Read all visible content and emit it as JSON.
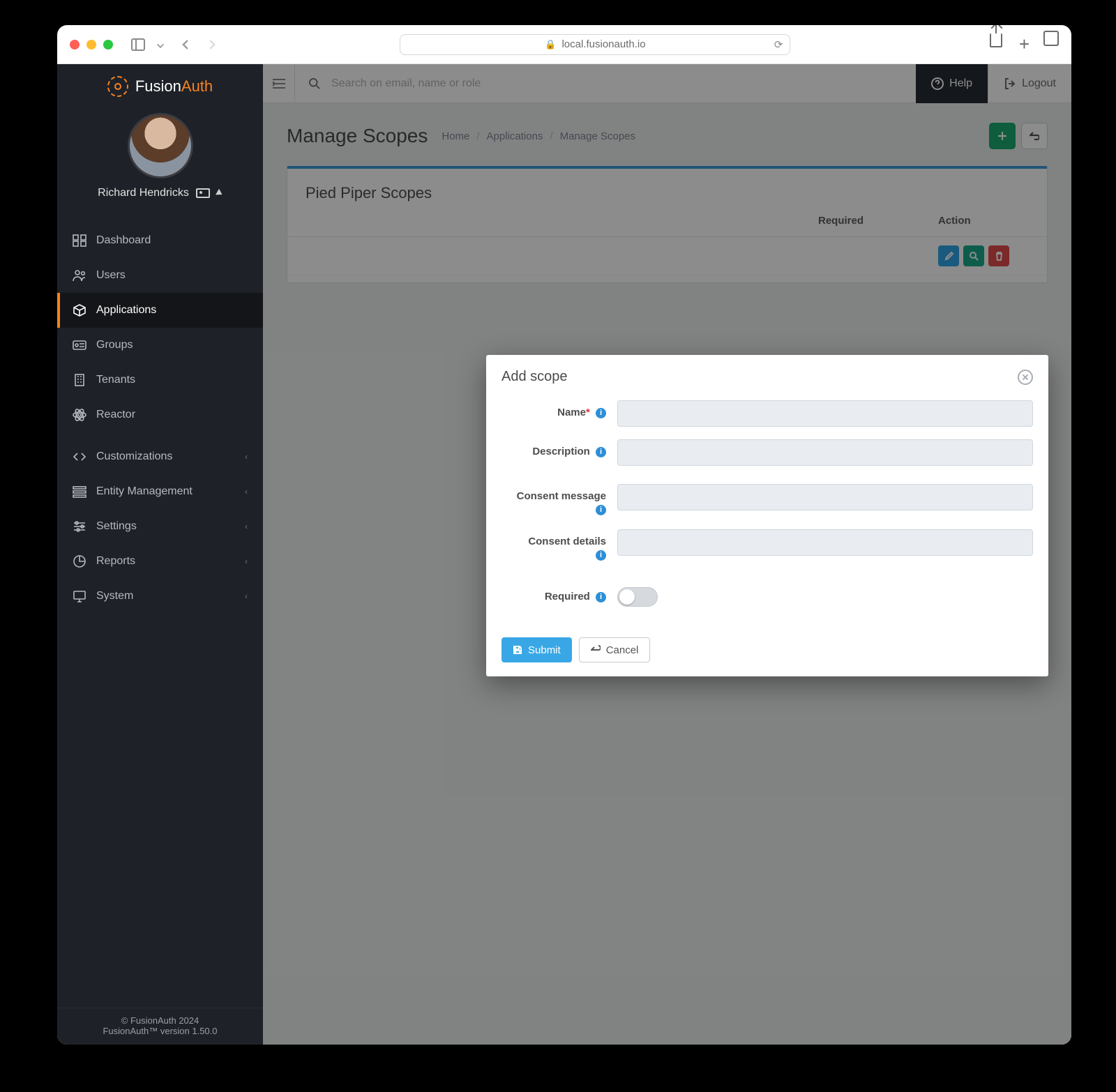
{
  "browser": {
    "address": "local.fusionauth.io"
  },
  "brand": {
    "name_a": "Fusion",
    "name_b": "Auth"
  },
  "user": {
    "name": "Richard Hendricks"
  },
  "footer": {
    "copyright": "© FusionAuth 2024",
    "version": "FusionAuth™ version 1.50.0"
  },
  "topbar": {
    "search_placeholder": "Search on email, name or role",
    "help": "Help",
    "logout": "Logout"
  },
  "page": {
    "title": "Manage Scopes",
    "crumbs": [
      "Home",
      "Applications",
      "Manage Scopes"
    ]
  },
  "panel": {
    "title": "Pied Piper Scopes",
    "columns": {
      "required": "Required",
      "action": "Action"
    }
  },
  "nav": [
    {
      "label": "Dashboard",
      "icon": "grid"
    },
    {
      "label": "Users",
      "icon": "users"
    },
    {
      "label": "Applications",
      "icon": "cube",
      "active": true
    },
    {
      "label": "Groups",
      "icon": "groups"
    },
    {
      "label": "Tenants",
      "icon": "building"
    },
    {
      "label": "Reactor",
      "icon": "atom"
    }
  ],
  "nav2": [
    {
      "label": "Customizations",
      "icon": "code"
    },
    {
      "label": "Entity Management",
      "icon": "entity"
    },
    {
      "label": "Settings",
      "icon": "sliders"
    },
    {
      "label": "Reports",
      "icon": "pie"
    },
    {
      "label": "System",
      "icon": "monitor"
    }
  ],
  "modal": {
    "title": "Add scope",
    "fields": {
      "name": "Name",
      "description": "Description",
      "consent_message": "Consent message",
      "consent_details": "Consent details",
      "required": "Required"
    },
    "submit": "Submit",
    "cancel": "Cancel",
    "values": {
      "name": "",
      "description": "",
      "consent_message": "",
      "consent_details": "",
      "required": false
    }
  }
}
